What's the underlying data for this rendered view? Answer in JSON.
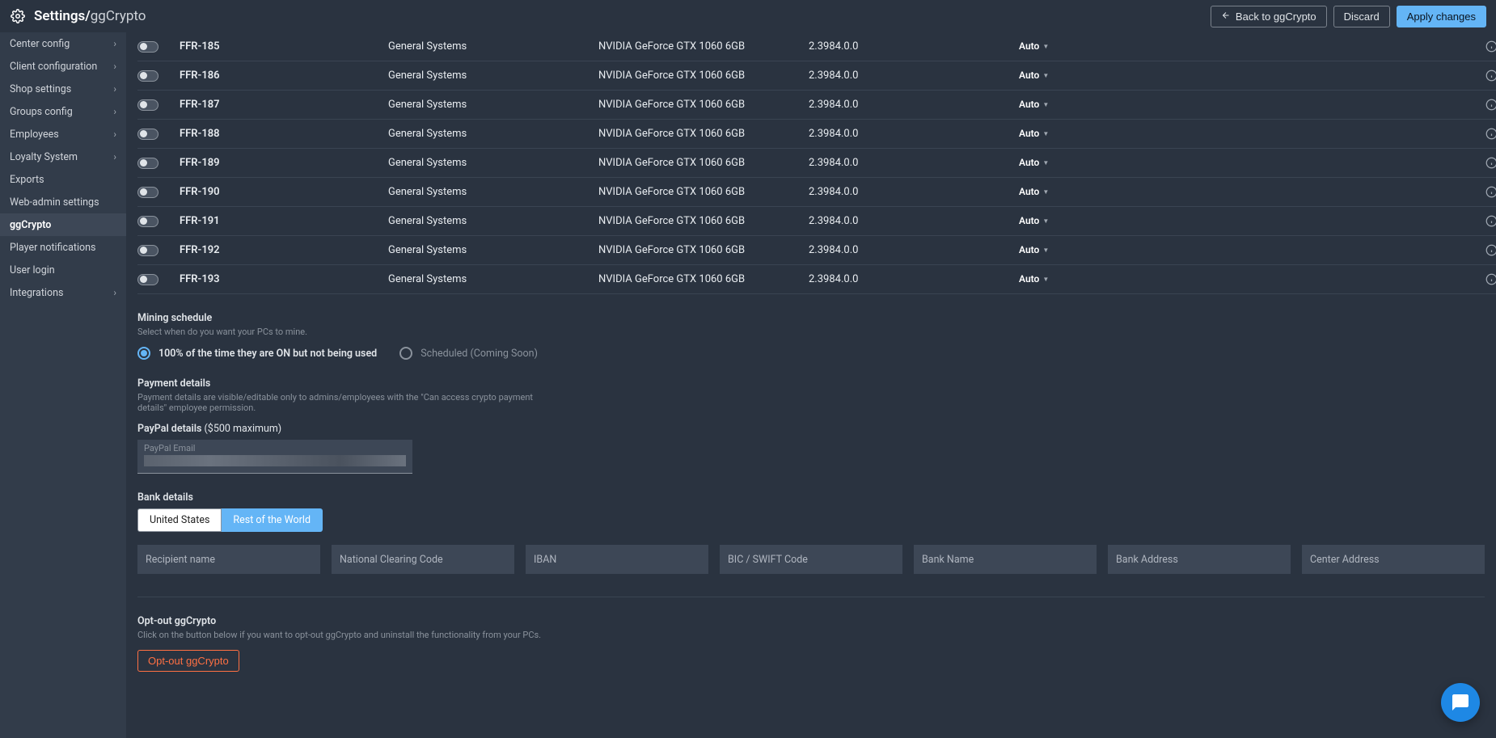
{
  "header": {
    "breadcrumb_root": "Settings",
    "breadcrumb_sub": "ggCrypto",
    "back_label": "Back to ggCrypto",
    "discard_label": "Discard",
    "apply_label": "Apply changes"
  },
  "sidebar": {
    "items": [
      {
        "label": "Center config",
        "chevron": true
      },
      {
        "label": "Client configuration",
        "chevron": true
      },
      {
        "label": "Shop settings",
        "chevron": true
      },
      {
        "label": "Groups config",
        "chevron": true
      },
      {
        "label": "Employees",
        "chevron": true
      },
      {
        "label": "Loyalty System",
        "chevron": true
      },
      {
        "label": "Exports",
        "chevron": false
      },
      {
        "label": "Web-admin settings",
        "chevron": false
      },
      {
        "label": "ggCrypto",
        "chevron": false,
        "active": true
      },
      {
        "label": "Player notifications",
        "chevron": false
      },
      {
        "label": "User login",
        "chevron": false
      },
      {
        "label": "Integrations",
        "chevron": true
      }
    ]
  },
  "table": {
    "rows": [
      {
        "name": "FFR-185",
        "system": "General Systems",
        "gpu": "NVIDIA GeForce GTX 1060 6GB",
        "version": "2.3984.0.0",
        "auto": "Auto"
      },
      {
        "name": "FFR-186",
        "system": "General Systems",
        "gpu": "NVIDIA GeForce GTX 1060 6GB",
        "version": "2.3984.0.0",
        "auto": "Auto"
      },
      {
        "name": "FFR-187",
        "system": "General Systems",
        "gpu": "NVIDIA GeForce GTX 1060 6GB",
        "version": "2.3984.0.0",
        "auto": "Auto"
      },
      {
        "name": "FFR-188",
        "system": "General Systems",
        "gpu": "NVIDIA GeForce GTX 1060 6GB",
        "version": "2.3984.0.0",
        "auto": "Auto"
      },
      {
        "name": "FFR-189",
        "system": "General Systems",
        "gpu": "NVIDIA GeForce GTX 1060 6GB",
        "version": "2.3984.0.0",
        "auto": "Auto"
      },
      {
        "name": "FFR-190",
        "system": "General Systems",
        "gpu": "NVIDIA GeForce GTX 1060 6GB",
        "version": "2.3984.0.0",
        "auto": "Auto"
      },
      {
        "name": "FFR-191",
        "system": "General Systems",
        "gpu": "NVIDIA GeForce GTX 1060 6GB",
        "version": "2.3984.0.0",
        "auto": "Auto"
      },
      {
        "name": "FFR-192",
        "system": "General Systems",
        "gpu": "NVIDIA GeForce GTX 1060 6GB",
        "version": "2.3984.0.0",
        "auto": "Auto"
      },
      {
        "name": "FFR-193",
        "system": "General Systems",
        "gpu": "NVIDIA GeForce GTX 1060 6GB",
        "version": "2.3984.0.0",
        "auto": "Auto"
      }
    ]
  },
  "mining": {
    "title": "Mining schedule",
    "desc": "Select when do you want your PCs to mine.",
    "opt1": "100% of the time they are ON but not being used",
    "opt2": "Scheduled (Coming Soon)"
  },
  "payment": {
    "title": "Payment details",
    "desc": "Payment details are visible/editable only to admins/employees with the \"Can access crypto payment details\" employee permission.",
    "paypal_title": "PayPal details",
    "paypal_sub": "($500 maximum)",
    "paypal_label": "PayPal Email"
  },
  "bank": {
    "title": "Bank details",
    "tab_us": "United States",
    "tab_rest": "Rest of the World",
    "fields": [
      "Recipient name",
      "National Clearing Code",
      "IBAN",
      "BIC / SWIFT Code",
      "Bank Name",
      "Bank Address",
      "Center Address"
    ]
  },
  "optout": {
    "title": "Opt-out ggCrypto",
    "desc": "Click on the button below if you want to opt-out ggCrypto and uninstall the functionality from your PCs.",
    "button": "Opt-out ggCrypto"
  }
}
